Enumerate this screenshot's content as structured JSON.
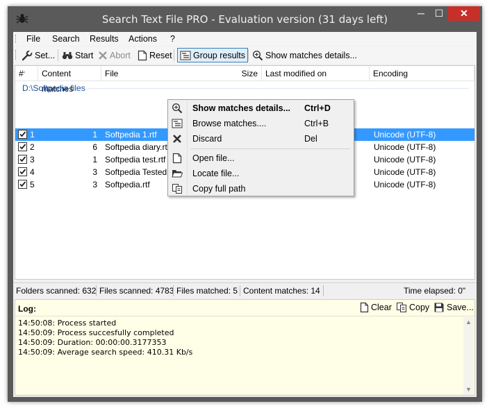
{
  "window": {
    "title": "Search Text File PRO - Evaluation version (31 days left)",
    "controls": {
      "minimize": "─",
      "maximize": "☐",
      "close": "✕"
    }
  },
  "menu": [
    "File",
    "Search",
    "Results",
    "Actions",
    "?"
  ],
  "toolbar": {
    "settings": "Set...",
    "start": "Start",
    "abort": "Abort",
    "reset": "Reset",
    "group_results": "Group results",
    "show_matches": "Show matches details..."
  },
  "columns": {
    "num": "#",
    "content_matches": "Content matches",
    "file": "File",
    "size": "Size",
    "modified": "Last modified on",
    "encoding": "Encoding"
  },
  "group": "D:\\Softpedia files",
  "rows": [
    {
      "num": "1",
      "matches": "1",
      "file": "Softpedia 1.rtf",
      "encoding": "Unicode (UTF-8)",
      "checked": true,
      "selected": true
    },
    {
      "num": "2",
      "matches": "6",
      "file": "Softpedia diary.rtf",
      "encoding": "Unicode (UTF-8)",
      "checked": true,
      "selected": false
    },
    {
      "num": "3",
      "matches": "1",
      "file": "Softpedia test.rtf",
      "encoding": "Unicode (UTF-8)",
      "checked": true,
      "selected": false
    },
    {
      "num": "4",
      "matches": "3",
      "file": "Softpedia Tested.rtf",
      "encoding": "Unicode (UTF-8)",
      "checked": true,
      "selected": false
    },
    {
      "num": "5",
      "matches": "3",
      "file": "Softpedia.rtf",
      "encoding": "Unicode (UTF-8)",
      "checked": true,
      "selected": false
    }
  ],
  "context_menu": [
    {
      "label": "Show matches details...",
      "shortcut": "Ctrl+D",
      "icon": "zoom-icon"
    },
    {
      "label": "Browse matches....",
      "shortcut": "Ctrl+B",
      "icon": "browse-icon"
    },
    {
      "label": "Discard",
      "shortcut": "Del",
      "icon": "discard-icon"
    },
    {
      "label": "Open file...",
      "shortcut": "",
      "icon": "file-icon"
    },
    {
      "label": "Locate file...",
      "shortcut": "",
      "icon": "folder-icon"
    },
    {
      "label": "Copy full path",
      "shortcut": "",
      "icon": "copy-icon"
    }
  ],
  "status": {
    "folders": "Folders scanned: 632",
    "files": "Files scanned: 4783",
    "matched": "Files matched: 5",
    "content": "Content matches: 14",
    "elapsed": "Time elapsed: 0\""
  },
  "log": {
    "title": "Log:",
    "clear": "Clear",
    "copy": "Copy",
    "save": "Save...",
    "lines": [
      "14:50:08: Process started",
      "14:50:09: Process succesfully completed",
      "14:50:09: Duration: 00:00:00.3177353",
      "14:50:09: Average search speed: 410.31 Kb/s"
    ]
  },
  "colors": {
    "selection": "#3399ff",
    "group_text": "#1a4f9c",
    "log_bg": "#ffffe8",
    "close_btn": "#c7302a"
  }
}
